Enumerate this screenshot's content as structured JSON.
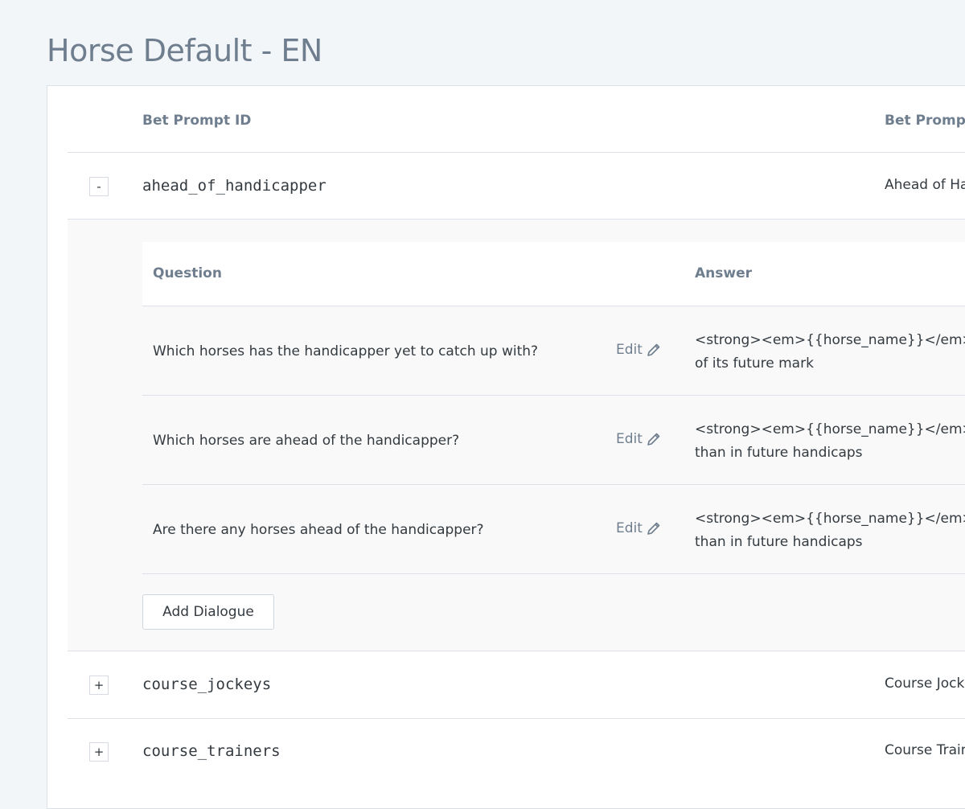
{
  "page": {
    "title": "Horse Default - EN"
  },
  "table": {
    "headers": {
      "bet_prompt_id": "Bet Prompt ID",
      "bet_prompt": "Bet Prompt"
    },
    "rows": [
      {
        "toggle": "-",
        "id": "ahead_of_handicapper",
        "prompt": "Ahead of Ha",
        "expanded": true
      },
      {
        "toggle": "+",
        "id": "course_jockeys",
        "prompt": "Course Jock",
        "expanded": false
      },
      {
        "toggle": "+",
        "id": "course_trainers",
        "prompt": "Course Train",
        "expanded": false
      }
    ]
  },
  "dialogue": {
    "headers": {
      "question": "Question",
      "answer": "Answer"
    },
    "items": [
      {
        "question": "Which horses has the handicapper yet to catch up with?",
        "edit_label": "Edit",
        "answer_line1": "<strong><em>{{horse_name}}</em></st",
        "answer_line2": "of its future mark"
      },
      {
        "question": "Which horses are ahead of the handicapper?",
        "edit_label": "Edit",
        "answer_line1": "<strong><em>{{horse_name}}</em></st",
        "answer_line2": "than in future handicaps"
      },
      {
        "question": "Are there any horses ahead of the handicapper?",
        "edit_label": "Edit",
        "answer_line1": "<strong><em>{{horse_name}}</em></st",
        "answer_line2": "than in future handicaps"
      }
    ],
    "add_button_label": "Add Dialogue"
  },
  "icons": {
    "edit": "pencil-icon"
  },
  "colors": {
    "page_background": "#f3f6f9",
    "title": "#6f7e8e",
    "header_text": "#6f7e8e",
    "body_text": "#333a40",
    "border": "#dbe1e6",
    "expanded_background": "#f9f9f9"
  }
}
